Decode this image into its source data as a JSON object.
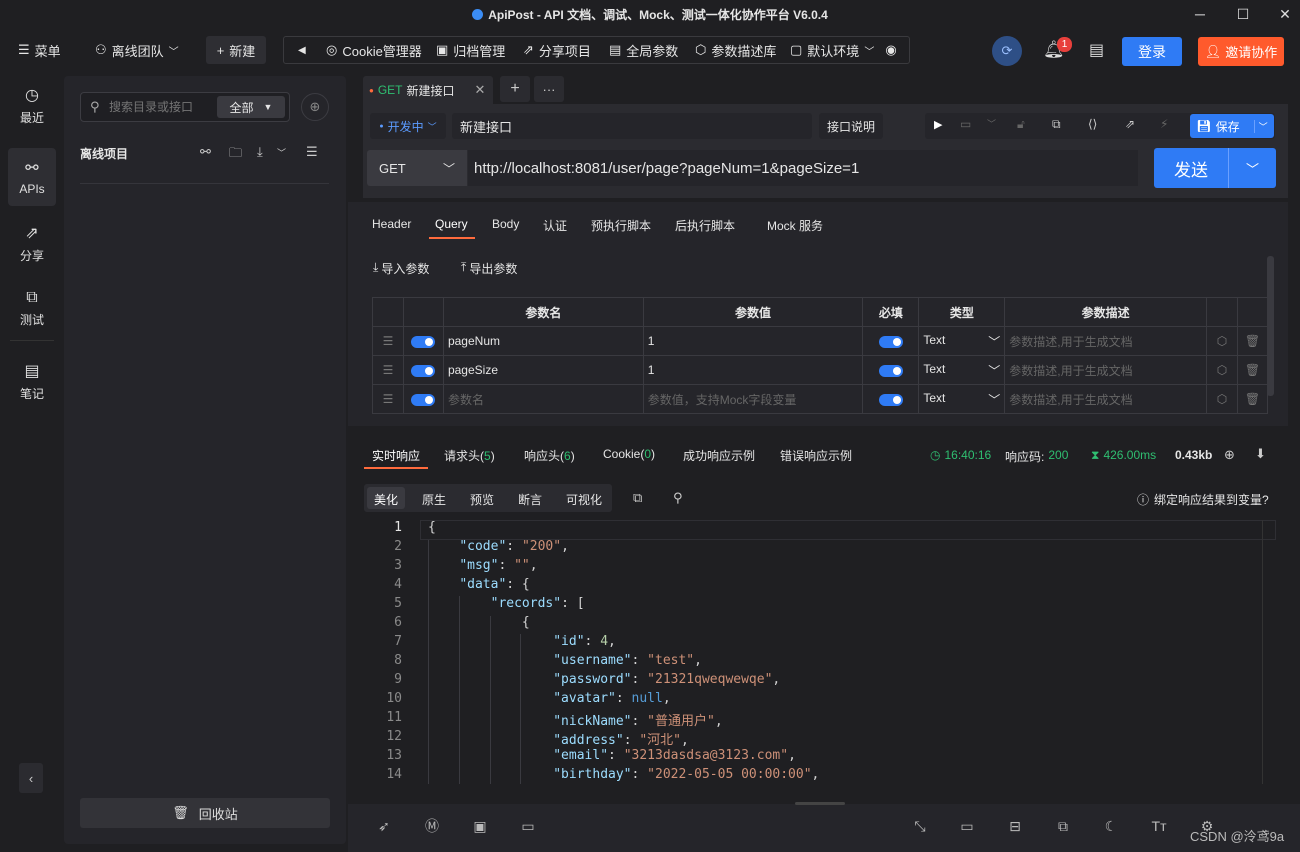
{
  "window": {
    "title": "ApiPost - API 文档、调试、Mock、测试一体化协作平台 V6.0.4"
  },
  "topbar": {
    "menu_label": "菜单",
    "team_label": "离线团队",
    "new_label": "新建",
    "cookie_label": "Cookie管理器",
    "archive_label": "归档管理",
    "share_label": "分享项目",
    "global_param_label": "全局参数",
    "param_desc_label": "参数描述库",
    "env_label": "默认环境",
    "notification_count": "1",
    "login_label": "登录",
    "invite_label": "邀请协作"
  },
  "leftnav": {
    "items": [
      {
        "label": "最近"
      },
      {
        "label": "APIs"
      },
      {
        "label": "分享"
      },
      {
        "label": "测试"
      },
      {
        "label": "笔记"
      }
    ]
  },
  "sidebar": {
    "search_placeholder": "搜索目录或接口",
    "filter_label": "全部",
    "project_label": "离线项目",
    "recycle_label": "回收站"
  },
  "request_tab": {
    "method": "GET",
    "name": "新建接口"
  },
  "request": {
    "status_label": "开发中",
    "name_value": "新建接口",
    "doc_label": "接口说明",
    "save_label": "保存",
    "method": "GET",
    "url": "http://localhost:8081/user/page?pageNum=1&pageSize=1",
    "send_label": "发送"
  },
  "param_tabs": [
    "Header",
    "Query",
    "Body",
    "认证",
    "预执行脚本",
    "后执行脚本",
    "Mock 服务"
  ],
  "param_actions": {
    "import_label": "导入参数",
    "export_label": "导出参数"
  },
  "param_table": {
    "headers": [
      "参数名",
      "参数值",
      "必填",
      "类型",
      "参数描述"
    ],
    "rows": [
      {
        "name": "pageNum",
        "value": "1",
        "type": "Text",
        "desc_placeholder": "参数描述,用于生成文档"
      },
      {
        "name": "pageSize",
        "value": "1",
        "type": "Text",
        "desc_placeholder": "参数描述,用于生成文档"
      },
      {
        "name_placeholder": "参数名",
        "value_placeholder": "参数值，支持Mock字段变量",
        "type": "Text",
        "desc_placeholder": "参数描述,用于生成文档"
      }
    ]
  },
  "response_tabs": {
    "realtime": "实时响应",
    "req_headers": "请求头",
    "req_headers_count": "5",
    "resp_headers": "响应头",
    "resp_headers_count": "6",
    "cookie": "Cookie",
    "cookie_count": "0",
    "success_example": "成功响应示例",
    "error_example": "错误响应示例"
  },
  "response_meta": {
    "time": "16:40:16",
    "code_label": "响应码:",
    "code": "200",
    "duration": "426.00ms",
    "size": "0.43kb"
  },
  "view_tabs": [
    "美化",
    "原生",
    "预览",
    "断言",
    "可视化"
  ],
  "bind_label": "绑定响应结果到变量?",
  "watermark": "CSDN @泠鸢9a"
}
